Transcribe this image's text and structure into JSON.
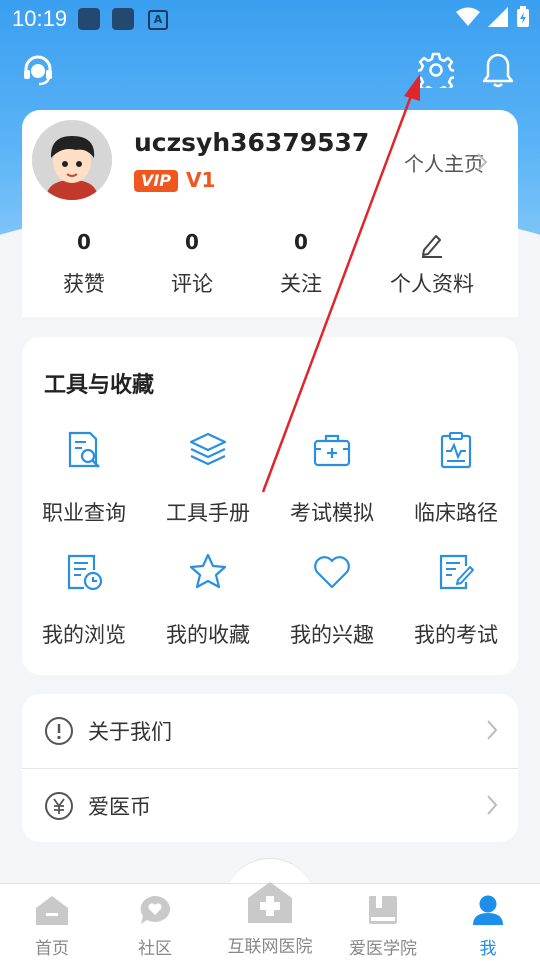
{
  "status_bar": {
    "time": "10:19"
  },
  "header": {
    "support_icon": "headset-icon",
    "settings_icon": "gear-icon",
    "notification_icon": "bell-icon"
  },
  "profile": {
    "username": "uczsyh36379537",
    "vip_badge": "VIP",
    "level": "V1",
    "homepage_label": "个人主页",
    "stats": [
      {
        "value": "0",
        "label": "获赞"
      },
      {
        "value": "0",
        "label": "评论"
      },
      {
        "value": "0",
        "label": "关注"
      }
    ],
    "edit_profile_label": "个人资料"
  },
  "tools": {
    "title": "工具与收藏",
    "items": [
      {
        "label": "职业查询",
        "icon": "document-search-icon"
      },
      {
        "label": "工具手册",
        "icon": "layers-icon"
      },
      {
        "label": "考试模拟",
        "icon": "medical-kit-icon"
      },
      {
        "label": "临床路径",
        "icon": "clipboard-pulse-icon"
      },
      {
        "label": "我的浏览",
        "icon": "history-icon"
      },
      {
        "label": "我的收藏",
        "icon": "star-icon"
      },
      {
        "label": "我的兴趣",
        "icon": "heart-icon"
      },
      {
        "label": "我的考试",
        "icon": "exam-edit-icon"
      }
    ]
  },
  "menu": [
    {
      "label": "关于我们",
      "icon": "info-icon"
    },
    {
      "label": "爱医币",
      "icon": "yuan-coin-icon"
    }
  ],
  "tabbar": [
    {
      "label": "首页",
      "icon": "home-icon",
      "active": false
    },
    {
      "label": "社区",
      "icon": "community-icon",
      "active": false
    },
    {
      "label": "互联网医院",
      "icon": "hospital-icon",
      "active": false
    },
    {
      "label": "爱医学院",
      "icon": "book-icon",
      "active": false
    },
    {
      "label": "我",
      "icon": "user-icon",
      "active": true
    }
  ],
  "colors": {
    "accent": "#1d8ee9",
    "icon_blue": "#2a8fe0",
    "vip": "#f0571f",
    "annotation_arrow": "#e0262a"
  }
}
